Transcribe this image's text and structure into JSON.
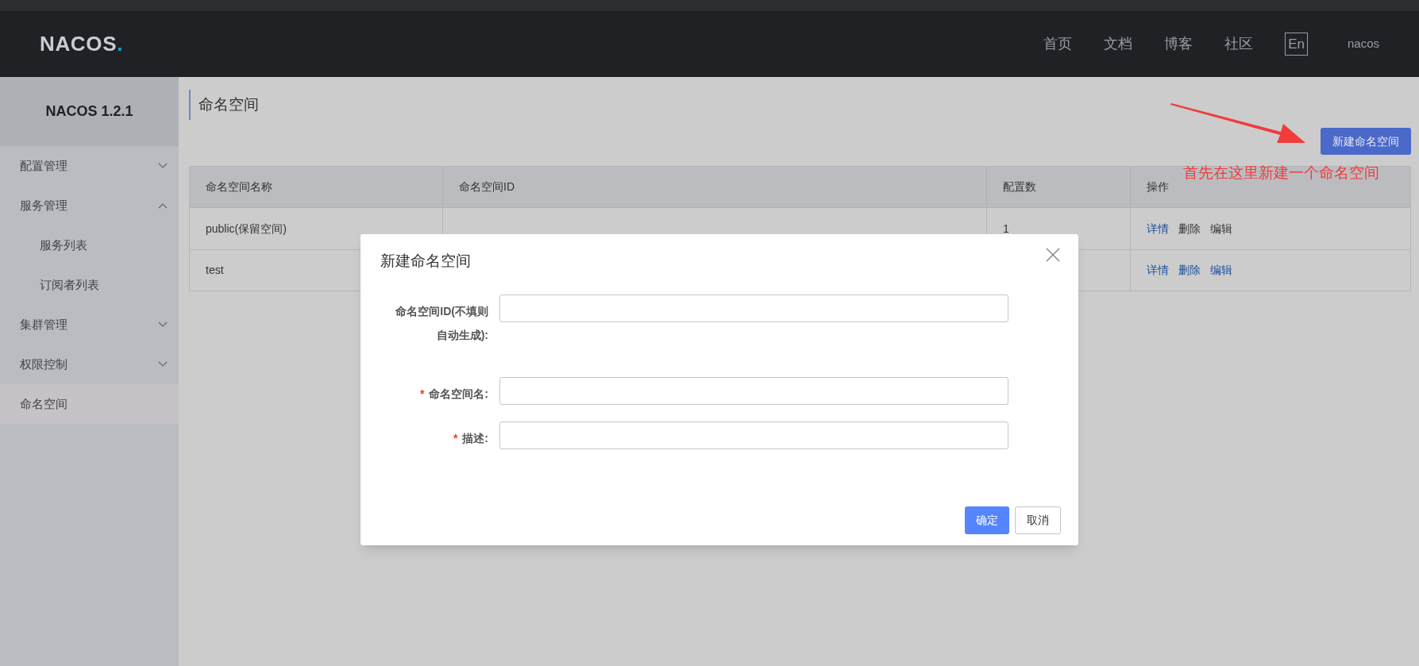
{
  "topbar": {
    "logo": {
      "text": "NACOS",
      "dot": "."
    },
    "nav": [
      "首页",
      "文档",
      "博客",
      "社区"
    ],
    "language": "En",
    "user": "nacos"
  },
  "sidebar": {
    "title": "NACOS 1.2.1",
    "items": [
      {
        "label": "配置管理",
        "expanded": false,
        "selected": false
      },
      {
        "label": "服务管理",
        "expanded": true,
        "selected": false,
        "children": [
          {
            "label": "服务列表",
            "selected": false
          },
          {
            "label": "订阅者列表",
            "selected": false
          }
        ]
      },
      {
        "label": "集群管理",
        "expanded": false,
        "selected": false
      },
      {
        "label": "权限控制",
        "expanded": false,
        "selected": false
      },
      {
        "label": "命名空间",
        "selected": true
      }
    ]
  },
  "page": {
    "title": "命名空间",
    "create_button": "新建命名空间",
    "annotation": "首先在这里新建一个命名空间"
  },
  "table": {
    "columns": [
      "命名空间名称",
      "命名空间ID",
      "配置数",
      "操作"
    ],
    "rows": [
      {
        "name": "public(保留空间)",
        "count": "1",
        "actions": [
          {
            "label": "详情",
            "color": "#1a4d9c"
          },
          {
            "label": "删除",
            "color": "#333333"
          },
          {
            "label": "编辑",
            "color": "#333333"
          }
        ]
      },
      {
        "name": "test",
        "actions": [
          {
            "label": "详情",
            "color": "#1a4d9c"
          },
          {
            "label": "删除",
            "color": "#1a4d9c"
          },
          {
            "label": "编辑",
            "color": "#1a4d9c"
          }
        ]
      }
    ]
  },
  "dialog": {
    "title": "新建命名空间",
    "fields": [
      {
        "label": "命名空间ID(不填则自动生成):"
      },
      {
        "label": "命名空间名:",
        "required_mark": "*"
      },
      {
        "label": "描述:",
        "required_mark": "*"
      }
    ],
    "buttons": [
      {
        "label": "确定",
        "primary": true
      },
      {
        "label": "取消",
        "primary": false
      }
    ]
  }
}
